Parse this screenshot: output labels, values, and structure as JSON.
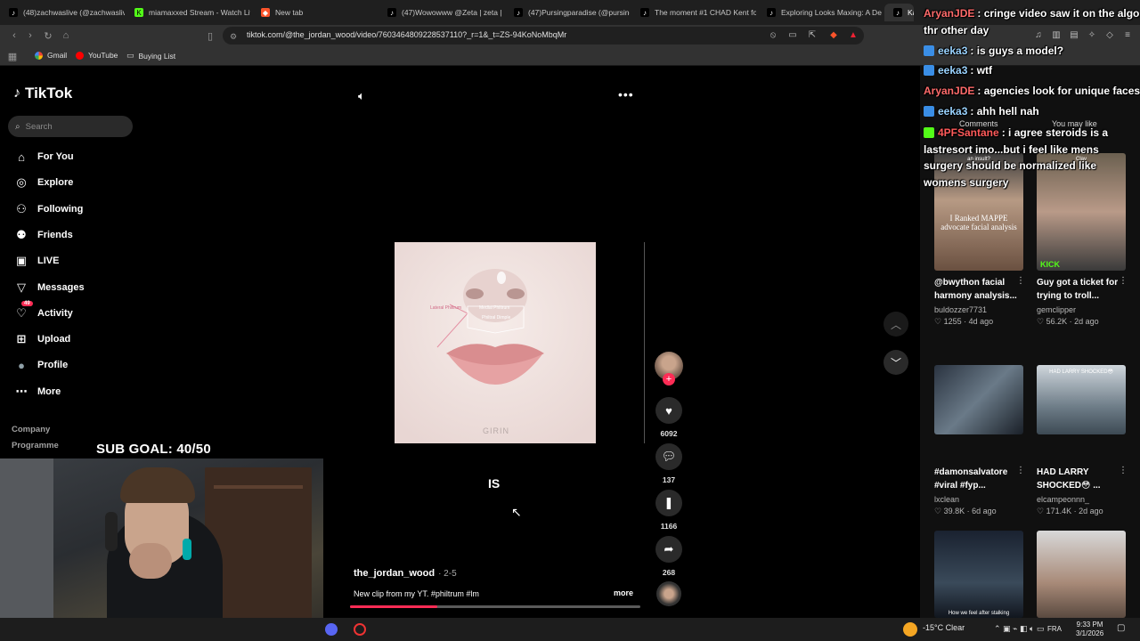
{
  "browser": {
    "tabs": [
      {
        "title": "(48)zachwaslive (@zachwaslive",
        "icon": "tiktok-icon"
      },
      {
        "title": "miamaxxed Stream - Watch Live",
        "icon": "kick-icon"
      },
      {
        "title": "New tab",
        "icon": "brave-icon"
      },
      {
        "title": "(47)Wowowww @Zeta | zeta |",
        "icon": "tiktok-icon"
      },
      {
        "title": "(47)Pursingparadise (@pursing",
        "icon": "tiktok-icon"
      },
      {
        "title": "The moment #1 CHAD Kent fo",
        "icon": "tiktok-icon"
      },
      {
        "title": "Exploring Looks Maxing: A De",
        "icon": "tiktok-icon"
      },
      {
        "title": "Ka",
        "icon": "tiktok-icon"
      }
    ],
    "url": "tiktok.com/@the_jordan_wood/video/7603464809228537110?_r=1&_t=ZS-94KoNoMbqMr",
    "bookmarks": [
      {
        "label": "Gmail",
        "icon": "google-icon"
      },
      {
        "label": "YouTube",
        "icon": "youtube-icon"
      },
      {
        "label": "Buying List",
        "icon": "folder-icon"
      }
    ]
  },
  "tiktok": {
    "logo": "TikTok",
    "search_placeholder": "Search",
    "nav": [
      {
        "label": "For You",
        "icon": "home-icon"
      },
      {
        "label": "Explore",
        "icon": "compass-icon"
      },
      {
        "label": "Following",
        "icon": "following-icon"
      },
      {
        "label": "Friends",
        "icon": "friends-icon"
      },
      {
        "label": "LIVE",
        "icon": "live-icon"
      },
      {
        "label": "Messages",
        "icon": "messages-icon"
      },
      {
        "label": "Activity",
        "icon": "activity-icon",
        "badge": "49"
      },
      {
        "label": "Upload",
        "icon": "upload-icon"
      },
      {
        "label": "Profile",
        "icon": "profile-avatar"
      },
      {
        "label": "More",
        "icon": "more-icon"
      }
    ],
    "footer": [
      "Company",
      "Programme"
    ],
    "video": {
      "caption_word": "IS",
      "watermark": "GIRIN",
      "overlay_labels": [
        "Lateral Philtrum",
        "Medial Philtrum",
        "Philtral Dimple"
      ],
      "author": "the_jordan_wood",
      "date": "2-5",
      "description": "New clip from my YT. #philtrum #lm",
      "more_label": "more",
      "progress": 0.3,
      "likes": "6092",
      "comments": "137",
      "saves": "1166",
      "shares": "268"
    },
    "right_panel": {
      "tabs": [
        "Comments",
        "You may like"
      ],
      "recommendations": [
        {
          "title": "@bwython facial harmony analysis...",
          "user": "buldozzer7731",
          "likes": "1255",
          "age": "4d ago",
          "thumb_text": "I Ranked MAPPE advocate facial analysis",
          "thumb_top": "an insult?"
        },
        {
          "title": "Guy got a ticket for trying to troll...",
          "user": "gemclipper",
          "likes": "56.2K",
          "age": "2d ago",
          "thumb_text": "KICK",
          "thumb_top": "Clav"
        },
        {
          "title": "#damonsalvatore #viral #fyp...",
          "user": "lxclean",
          "likes": "39.8K",
          "age": "6d ago",
          "thumb_text": "",
          "thumb_top": ""
        },
        {
          "title": "HAD LARRY SHOCKED😳 ...",
          "user": "elcampeonnn_",
          "likes": "171.4K",
          "age": "2d ago",
          "thumb_text": "",
          "thumb_top": "HAD LARRY SHOCKED😳"
        },
        {
          "title": "",
          "user": "",
          "likes": "",
          "age": "",
          "thumb_text": "How we feel after stalking",
          "thumb_top": ""
        },
        {
          "title": "",
          "user": "",
          "likes": "",
          "age": "",
          "thumb_text": "",
          "thumb_top": ""
        }
      ]
    }
  },
  "stream": {
    "sub_goal": "SUB GOAL: 40/50",
    "chat": [
      {
        "user": "AryanJDE",
        "text": ": cringe video saw it on the algo",
        "continuation": "thr other day",
        "user_color": "#ff6b6b",
        "icon_color": ""
      },
      {
        "user": "eeka3",
        "text": ": is guys a model?",
        "continuation": "",
        "user_color": "#9ad3ff",
        "icon_color": "#3a8ee6"
      },
      {
        "user": "eeka3",
        "text": ": wtf",
        "continuation": "",
        "user_color": "#9ad3ff",
        "icon_color": "#3a8ee6"
      },
      {
        "user": "AryanJDE",
        "text": ": agencies look for unique faces",
        "continuation": "",
        "user_color": "#ff6b6b",
        "icon_color": ""
      },
      {
        "user": "eeka3",
        "text": ": ahh hell nah",
        "continuation": "",
        "user_color": "#9ad3ff",
        "icon_color": "#3a8ee6"
      },
      {
        "user": "4PFSantane",
        "text": ": i agree steroids is a last",
        "continuation": "resort imo...but i feel like mens surgery should be normalized like womens surgery",
        "user_color": "#ff5a5a",
        "icon_color": "#53fc18"
      }
    ]
  },
  "taskbar": {
    "weather": "-15°C  Clear",
    "lang": "FRA",
    "time": "9:33 PM",
    "date": "3/1/2026"
  }
}
